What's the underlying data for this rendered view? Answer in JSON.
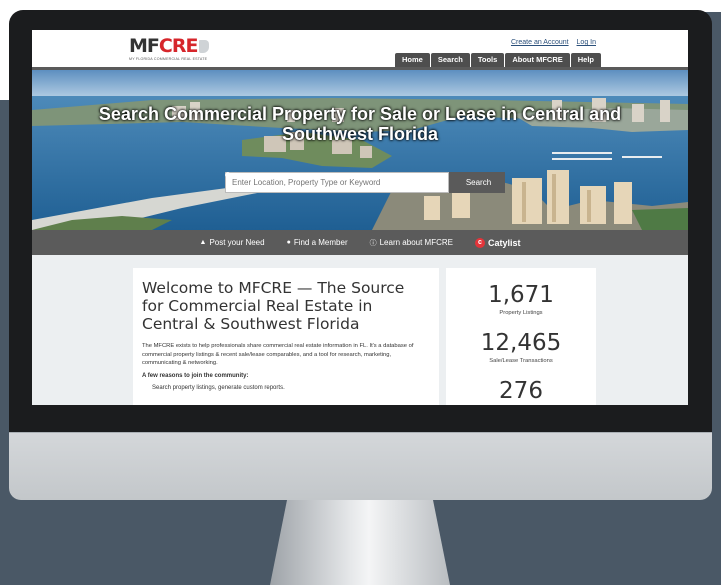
{
  "site": {
    "logo_text_a": "MF",
    "logo_text_b": "CRE",
    "logo_tagline": "MY FLORIDA COMMERCIAL REAL ESTATE",
    "auth": {
      "create_account": "Create an Account",
      "login": "Log In"
    },
    "nav": [
      "Home",
      "Search",
      "Tools",
      "About MFCRE",
      "Help"
    ]
  },
  "hero": {
    "title": "Search Commercial Property for Sale or Lease in Central and Southwest Florida",
    "search_placeholder": "Enter Location, Property Type or Keyword",
    "search_button": "Search"
  },
  "actions": [
    {
      "icon": "pin-icon",
      "label": "Post your Need"
    },
    {
      "icon": "person-icon",
      "label": "Find a Member"
    },
    {
      "icon": "info-icon",
      "label": "Learn about MFCRE"
    },
    {
      "icon": "catylist-logo-icon",
      "label": "Catylist"
    }
  ],
  "welcome": {
    "title": "Welcome to MFCRE — The Source for Commercial Real Estate in Central & Southwest Florida",
    "body": "The MFCRE exists to help professionals share commercial real estate information in FL. It's a database of commercial property listings & recent sale/lease comparables, and a tool for research, marketing, communicating & networking.",
    "reasons_heading": "A few reasons to join the community:",
    "reasons": [
      "Search property listings, generate custom reports."
    ]
  },
  "stats": [
    {
      "value": "1,671",
      "label": "Property Listings"
    },
    {
      "value": "12,465",
      "label": "Sale/Lease Transactions"
    },
    {
      "value": "276",
      "label": ""
    }
  ],
  "colors": {
    "accent_red": "#d6262b",
    "nav_gray": "#4e4e4e",
    "bar_gray": "#5b5b5b",
    "backdrop_slate": "#4a5866"
  }
}
